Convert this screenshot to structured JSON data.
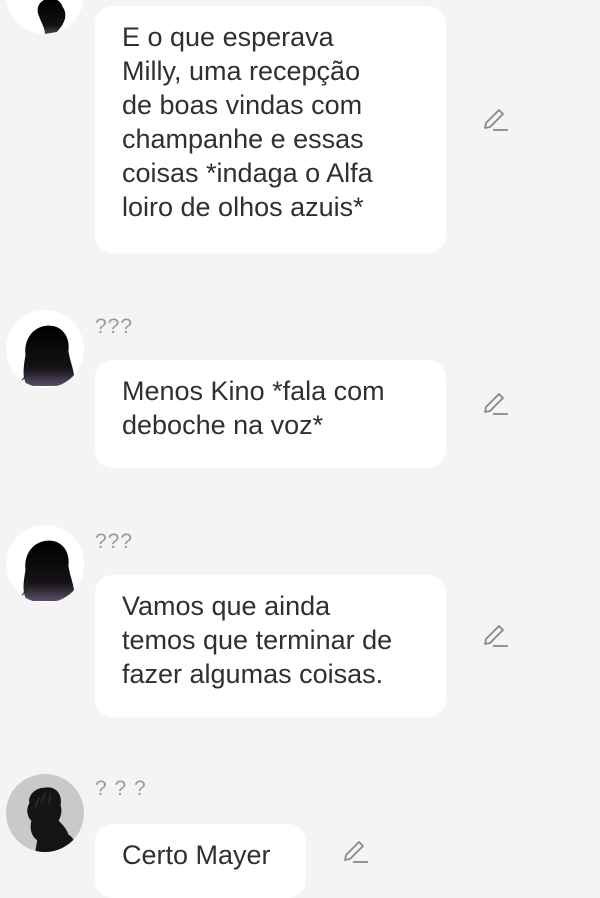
{
  "messages": [
    {
      "sender": "",
      "text_lines": [
        "E o que esperava",
        "Milly, uma recepção",
        "de boas vindas com",
        "champanhe e essas",
        "coisas *indaga o Alfa",
        "loiro de olhos azuis*"
      ],
      "avatar_icon": "female-silhouette-icon",
      "edit_icon": "pencil-icon"
    },
    {
      "sender": "???",
      "text_lines": [
        "Menos Kino *fala com",
        "deboche na voz*"
      ],
      "avatar_icon": "female-silhouette-icon",
      "edit_icon": "pencil-icon"
    },
    {
      "sender": "???",
      "text_lines": [
        "Vamos que ainda",
        "temos que terminar de",
        "fazer algumas coisas."
      ],
      "avatar_icon": "female-silhouette-icon",
      "edit_icon": "pencil-icon"
    },
    {
      "sender": "? ? ?",
      "text_lines": [
        "Certo Mayer"
      ],
      "avatar_icon": "male-silhouette-icon",
      "edit_icon": "pencil-icon"
    }
  ],
  "colors": {
    "background": "#f4f4f4",
    "bubble": "#ffffff",
    "text": "#303030",
    "sender": "#9a9a9a",
    "edit_icon": "#8a8a8a"
  }
}
